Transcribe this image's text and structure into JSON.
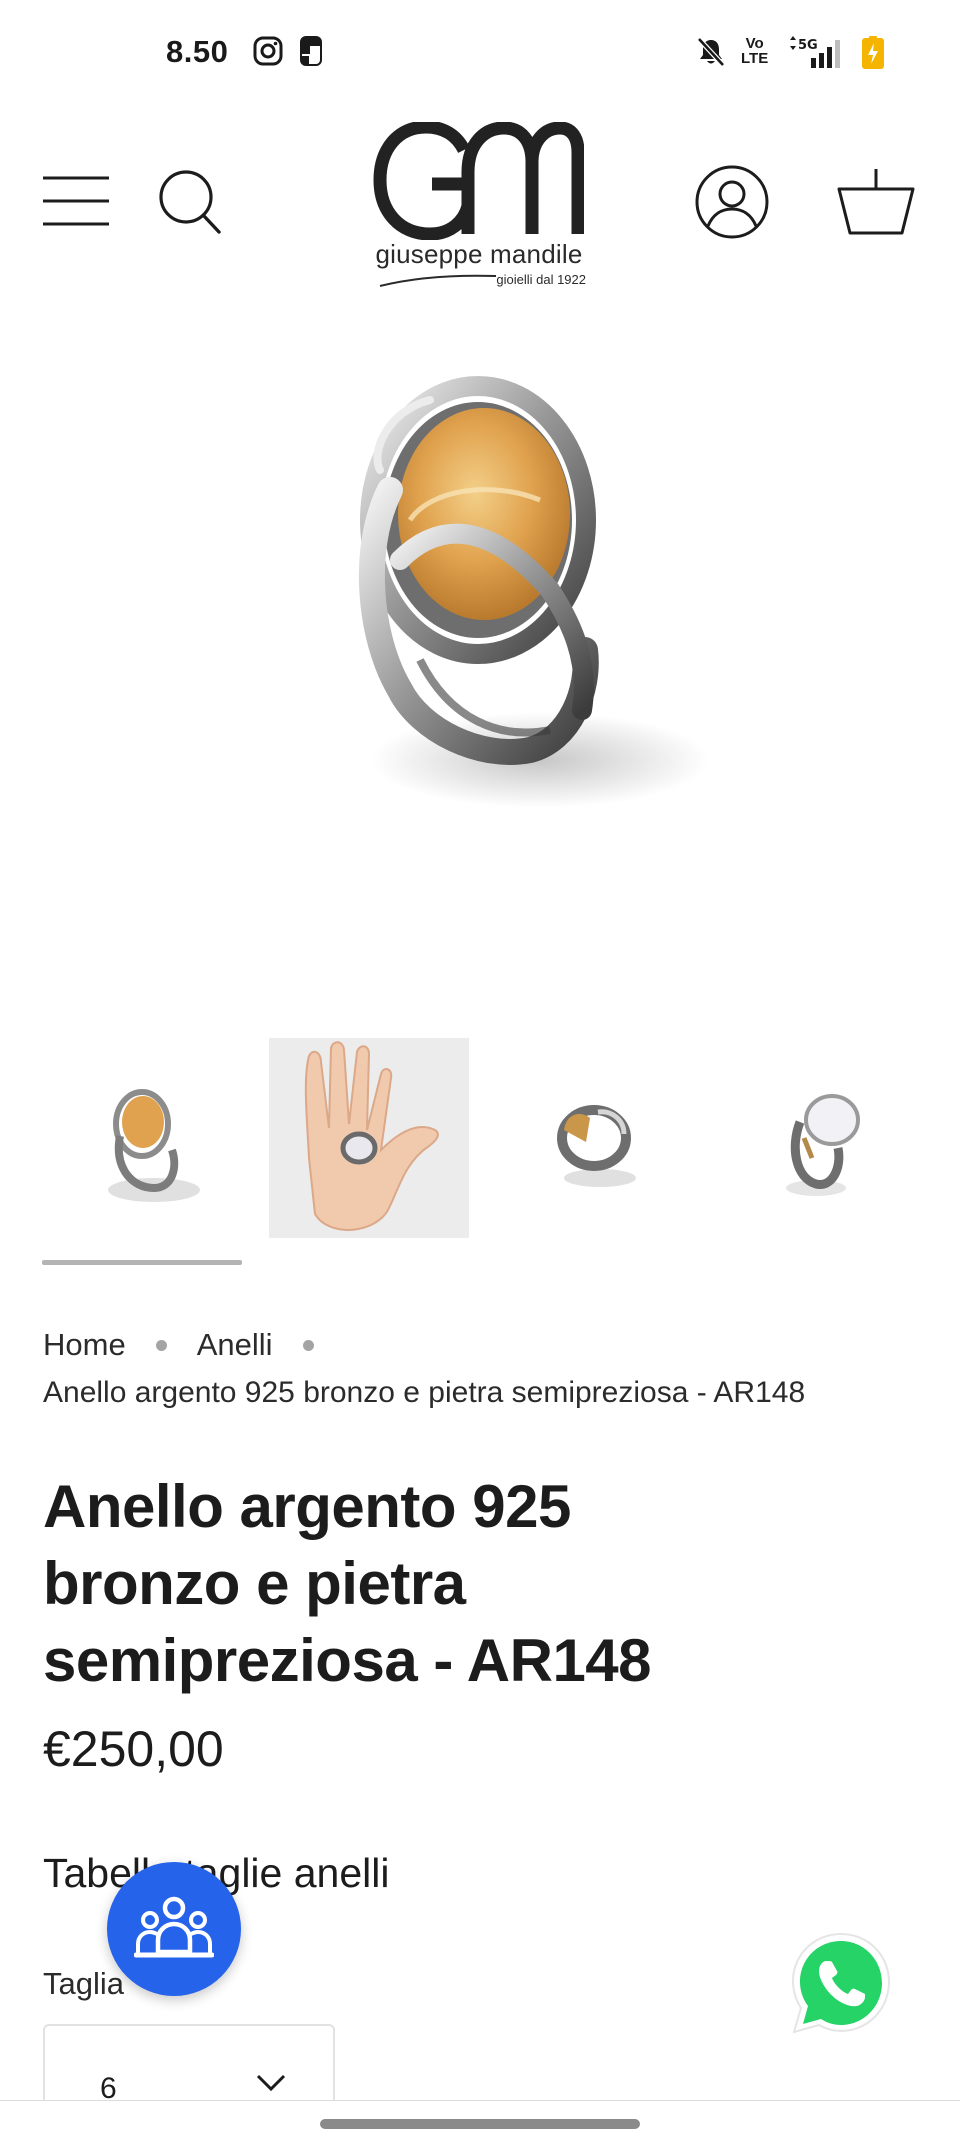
{
  "status_bar": {
    "time": "8.50",
    "volte_top": "Vo",
    "volte_bottom": "LTE",
    "network": "5G",
    "apps": [
      "instagram-icon",
      "flipboard-icon"
    ]
  },
  "header": {
    "logo": {
      "monogram": "GM",
      "name": "giuseppe mandile",
      "tagline": "gioielli dal 1922"
    },
    "icons": [
      "menu-icon",
      "search-icon",
      "account-icon",
      "cart-icon"
    ]
  },
  "gallery": {
    "thumbnail_count": 4,
    "active_index": 0
  },
  "breadcrumb": {
    "home": "Home",
    "category": "Anelli",
    "current": "Anello argento 925 bronzo e pietra semipreziosa - AR148"
  },
  "product": {
    "title_lines": [
      "Anello argento 925",
      "bronzo e pietra",
      "semipreziosa - AR148"
    ],
    "price": "€250,00",
    "size_chart_link": "Tabella taglie anelli",
    "size_label": "Taglia",
    "size_selected": "6"
  },
  "colors": {
    "text": "#1c1c1c",
    "community_fab": "#2563eb",
    "whatsapp": "#25d366",
    "battery": "#f5b400",
    "stone_amber": "#e0a24e",
    "silver": "#bcbcbc"
  }
}
